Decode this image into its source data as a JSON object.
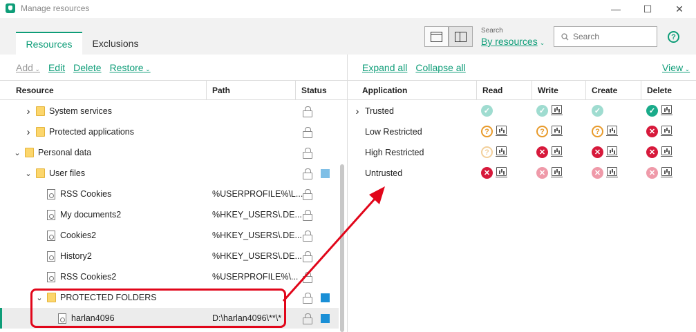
{
  "window": {
    "title": "Manage resources",
    "minimize_glyph": "—",
    "maximize_glyph": "☐",
    "close_glyph": "✕"
  },
  "tabs": [
    {
      "label": "Resources"
    },
    {
      "label": "Exclusions"
    }
  ],
  "search": {
    "label": "Search",
    "mode": "By resources",
    "placeholder": "Search"
  },
  "toolbar_left": {
    "add": "Add",
    "edit": "Edit",
    "delete": "Delete",
    "restore": "Restore"
  },
  "toolbar_right": {
    "expand": "Expand all",
    "collapse": "Collapse all",
    "view": "View"
  },
  "left_columns": {
    "resource": "Resource",
    "path": "Path",
    "status": "Status"
  },
  "right_columns": {
    "application": "Application",
    "read": "Read",
    "write": "Write",
    "create": "Create",
    "delete": "Delete"
  },
  "resources": [
    {
      "name": "System services",
      "path": "",
      "type": "folder",
      "level": 1,
      "expander": "collapsed",
      "status": "",
      "selected": false
    },
    {
      "name": "Protected applications",
      "path": "",
      "type": "folder",
      "level": 1,
      "expander": "collapsed",
      "status": "",
      "selected": false
    },
    {
      "name": "Personal data",
      "path": "",
      "type": "folder",
      "level": 0,
      "expander": "expanded",
      "status": "",
      "selected": false
    },
    {
      "name": "User files",
      "path": "",
      "type": "folder",
      "level": 1,
      "expander": "expanded",
      "status": "#7fbfe6",
      "selected": false
    },
    {
      "name": "RSS Cookies",
      "path": "%USERPROFILE%\\L...",
      "type": "file",
      "level": 2,
      "expander": "",
      "status": "",
      "selected": false
    },
    {
      "name": "My documents2",
      "path": "%HKEY_USERS\\.DE...",
      "type": "file",
      "level": 2,
      "expander": "",
      "status": "",
      "selected": false
    },
    {
      "name": "Cookies2",
      "path": "%HKEY_USERS\\.DE...",
      "type": "file",
      "level": 2,
      "expander": "",
      "status": "",
      "selected": false
    },
    {
      "name": "History2",
      "path": "%HKEY_USERS\\.DE...",
      "type": "file",
      "level": 2,
      "expander": "",
      "status": "",
      "selected": false
    },
    {
      "name": "RSS Cookies2",
      "path": "%USERPROFILE%\\...",
      "type": "file",
      "level": 2,
      "expander": "",
      "status": "",
      "selected": false
    },
    {
      "name": "PROTECTED FOLDERS",
      "path": "",
      "type": "folder",
      "level": 2,
      "expander": "expanded",
      "status": "#1a8fd6",
      "selected": false
    },
    {
      "name": "harlan4096",
      "path": "D:\\harlan4096\\**\\*",
      "type": "file",
      "level": 3,
      "expander": "",
      "status": "#1a8fd6",
      "selected": true
    }
  ],
  "applications": [
    {
      "name": "Trusted",
      "expander": true,
      "read": "allow-l",
      "write": "allow-l",
      "create": "allow-l",
      "delete": "allow",
      "read_log": false,
      "write_log": true,
      "create_log": false,
      "delete_log": true
    },
    {
      "name": "Low Restricted",
      "expander": false,
      "read": "ask",
      "write": "ask",
      "create": "ask",
      "delete": "deny",
      "read_log": true,
      "write_log": true,
      "create_log": true,
      "delete_log": true
    },
    {
      "name": "High Restricted",
      "expander": false,
      "read": "ask-l",
      "write": "deny",
      "create": "deny",
      "delete": "deny",
      "read_log": true,
      "write_log": true,
      "create_log": true,
      "delete_log": true
    },
    {
      "name": "Untrusted",
      "expander": false,
      "read": "deny",
      "write": "deny-l",
      "create": "deny-l",
      "delete": "deny-l",
      "read_log": true,
      "write_log": true,
      "create_log": true,
      "delete_log": true
    }
  ],
  "colors": {
    "accent": "#0e9d78",
    "annotation": "#e1061a"
  },
  "icons": {
    "app": "kaspersky-logo-icon",
    "help": "help-icon",
    "search": "search-icon",
    "lock": "lock-icon",
    "log": "monitor-log-icon"
  }
}
